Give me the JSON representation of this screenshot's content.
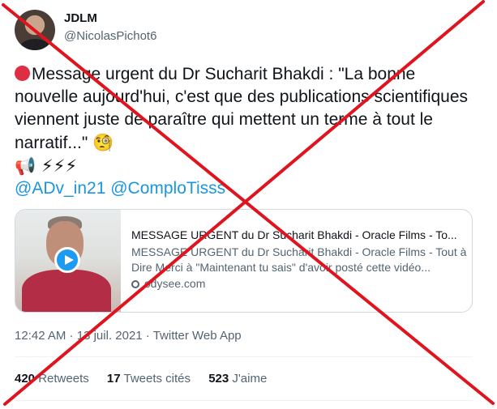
{
  "author": {
    "name": "JDLM",
    "handle": "@NicolasPichot6"
  },
  "tweet": {
    "line1": "Message urgent du Dr Sucharit Bhakdi : \"La bonne nouvelle aujourd'hui, c'est que des publications scientifiques viennent juste de paraître qui mettent un terme à tout le narratif...\"",
    "emoji_face": "🧐",
    "emoji_row": "📢 ⚡⚡⚡",
    "mention1": "@ADv_in21",
    "mention2": "@ComploTisss"
  },
  "card": {
    "title": "MESSAGE URGENT du Dr Sucharit Bhakdi - Oracle Films - To...",
    "description": "MESSAGE URGENT du Dr Sucharit Bhakdi - Oracle Films - Tout à Dire Merci à \"Maintenant tu sais\" d'avoir posté cette vidéo...",
    "domain": "odysee.com"
  },
  "meta": {
    "time": "12:42 AM",
    "sep1": " · ",
    "date": "13 juil. 2021",
    "sep2": " · ",
    "source": "Twitter Web App"
  },
  "stats": {
    "retweets_count": "420",
    "retweets_label": "Retweets",
    "quotes_count": "17",
    "quotes_label": "Tweets cités",
    "likes_count": "523",
    "likes_label": "J'aime"
  },
  "colors": {
    "link": "#1b95e0",
    "cross": "#e0141e"
  }
}
